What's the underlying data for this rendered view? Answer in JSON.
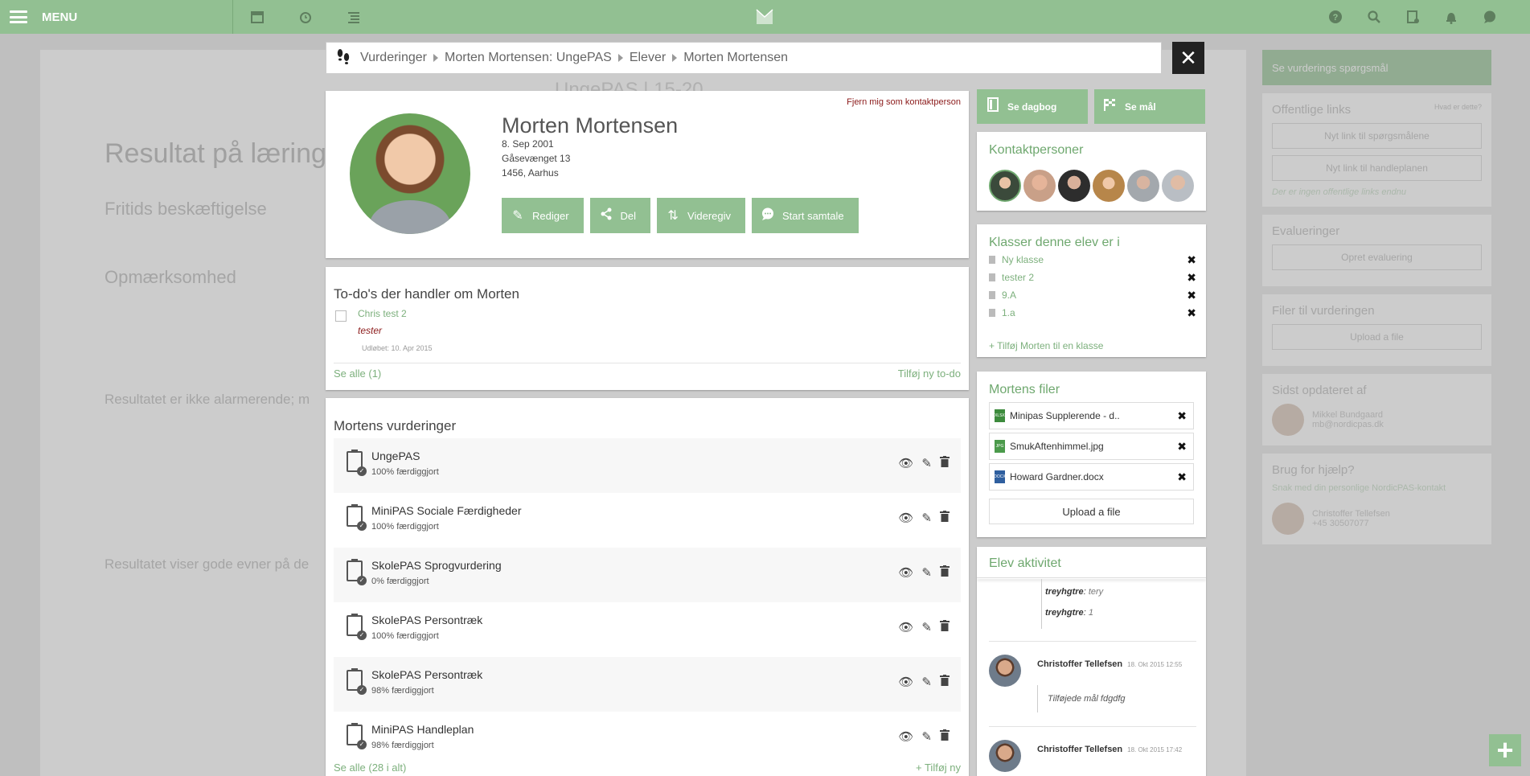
{
  "topbar": {
    "menu_label": "MENU",
    "left_icons": [
      "calendar-icon",
      "alarm-icon",
      "list-icon"
    ],
    "right_icons": [
      "help-icon",
      "search-icon",
      "clipboard-icon",
      "bell-icon",
      "chat-icon"
    ],
    "accent": "#92c092"
  },
  "breadcrumb": {
    "items": [
      "Vurderinger",
      "Morten Mortensen: UngePAS",
      "Elever",
      "Morten Mortensen"
    ]
  },
  "profile": {
    "remove_contact": "Fjern mig som kontaktperson",
    "name": "Morten Mortensen",
    "birthdate": "8. Sep 2001",
    "address": "Gåsevænget 13",
    "city": "1456, Aarhus",
    "buttons": {
      "edit": "Rediger",
      "share": "Del",
      "forward": "Videregiv",
      "chat": "Start samtale"
    }
  },
  "todo": {
    "title": "To-do's der handler om Morten",
    "item_name": "Chris test 2",
    "item_desc": "tester",
    "item_expires": "Udløbet: 10. Apr 2015",
    "see_all": "Se alle (1)",
    "add_new": "Tilføj ny to-do"
  },
  "evaluations": {
    "title": "Mortens vurderinger",
    "items": [
      {
        "name": "UngePAS",
        "progress": "100% færdiggjort"
      },
      {
        "name": "MiniPAS Sociale Færdigheder",
        "progress": "100% færdiggjort"
      },
      {
        "name": "SkolePAS Sprogvurdering",
        "progress": "0% færdiggjort"
      },
      {
        "name": "SkolePAS Persontræk",
        "progress": "100% færdiggjort"
      },
      {
        "name": "SkolePAS Persontræk",
        "progress": "98% færdiggjort"
      },
      {
        "name": "MiniPAS Handleplan",
        "progress": "98% færdiggjort"
      }
    ],
    "see_all": "Se alle (28 i alt)",
    "add_new": "+ Tilføj ny"
  },
  "right": {
    "diary_button": "Se dagbog",
    "goals_button": "Se mål",
    "contacts_title": "Kontaktpersoner",
    "contact_colors": [
      "#3b4a3b",
      "#c9a088",
      "#2d2d2d",
      "#b7864a",
      "#a3a8ad",
      "#b9bec4"
    ],
    "classes_title": "Klasser denne elev er i",
    "classes": [
      "Ny klasse",
      "tester 2",
      "9.A",
      "1.a"
    ],
    "add_class": "+ Tilføj Morten til en klasse",
    "files_title": "Mortens filer",
    "files": [
      {
        "name": "Minipas Supplerende - d..",
        "type": "XLSX",
        "color": "#3d8b3d"
      },
      {
        "name": "SmukAftenhimmel.jpg",
        "type": "JPG",
        "color": "#4b9a4b"
      },
      {
        "name": "Howard Gardner.docx",
        "type": "DOCX",
        "color": "#2f5f9f"
      }
    ],
    "upload_label": "Upload a file",
    "activity_title": "Elev aktivitet",
    "activity_fields": [
      {
        "label": "treyhgtre",
        "value": "tery"
      },
      {
        "label": "treyhgtre",
        "value": "1"
      }
    ],
    "activity_entries": [
      {
        "who": "Christoffer Tellefsen",
        "when": "18. Okt 2015 12:55",
        "msg": "Tilføjede mål fdgdfg"
      },
      {
        "who": "Christoffer Tellefsen",
        "when": "18. Okt 2015 17:42",
        "msg": ""
      }
    ]
  },
  "background": {
    "heading": "Resultat på læring",
    "subtitle": "UngePAS | 15-20",
    "sections": [
      "Fritids beskæftigelse",
      "Opmærksomhed",
      "Resultatet er ikke alarmerende; m",
      "Resultatet viser gode evner på de"
    ],
    "side_button": "Se vurderings spørgsmål",
    "public_links_title": "Offentlige links",
    "public_links_hint": "Hvad er dette?",
    "new_link_questions": "Nyt link til spørgsmålene",
    "new_link_plan": "Nyt link til handleplanen",
    "no_links": "Der er ingen offentlige links endnu",
    "evaluations_title": "Evalueringer",
    "create_evaluation": "Opret evaluering",
    "files_title": "Filer til vurderingen",
    "upload_label": "Upload a file",
    "updated_title": "Sidst opdateret af",
    "updated_name": "Mikkel Bundgaard",
    "updated_email": "mb@nordicpas.dk",
    "help_title": "Brug for hjælp?",
    "help_text": "Snak med din personlige NordicPAS-kontakt",
    "help_name": "Christoffer Tellefsen",
    "help_phone": "+45 30507077"
  }
}
